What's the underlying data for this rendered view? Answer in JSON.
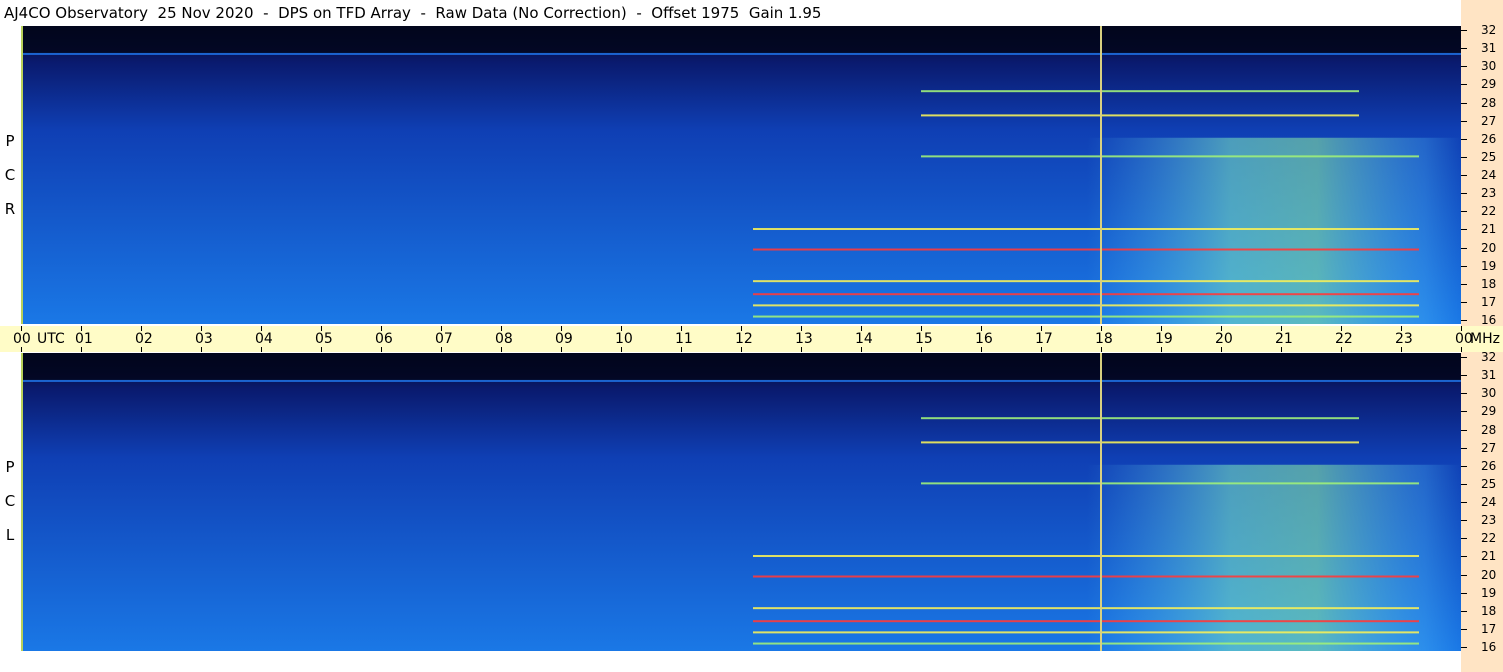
{
  "title": "AJ4CO Observatory  25 Nov 2020  -  DPS on TFD Array  -  Raw Data (No Correction)  -  Offset 1975  Gain 1.95",
  "panels": [
    {
      "id": "rcp",
      "label_chars": [
        "P",
        "C",
        "R"
      ]
    },
    {
      "id": "lcp",
      "label_chars": [
        "P",
        "C",
        "L"
      ]
    }
  ],
  "time_axis": {
    "unit": "UTC",
    "labels": [
      "00",
      "01",
      "02",
      "03",
      "04",
      "05",
      "06",
      "07",
      "08",
      "09",
      "10",
      "11",
      "12",
      "13",
      "14",
      "15",
      "16",
      "17",
      "18",
      "19",
      "20",
      "21",
      "22",
      "23",
      "00"
    ]
  },
  "freq_axis": {
    "unit": "MHz",
    "labels": [
      "32",
      "31",
      "30",
      "29",
      "28",
      "27",
      "26",
      "25",
      "24",
      "23",
      "22",
      "21",
      "20",
      "19",
      "18",
      "17",
      "16"
    ]
  },
  "colors": {
    "background_dark": "#0a1a6e",
    "sky_blue": "#1f6fe0",
    "signal_green": "#9ff07a",
    "signal_yellow": "#f5f05a",
    "signal_red": "#ff3a3a",
    "marker_line": "#d8d080",
    "axis_bg_time": "#fffcc7",
    "axis_bg_freq": "#ffe4c4"
  },
  "chart_data": [
    {
      "type": "heatmap",
      "title": "",
      "polarization": "RCP",
      "xlabel": "UTC",
      "ylabel": "MHz",
      "xlim": [
        0,
        24
      ],
      "ylim": [
        16,
        32
      ],
      "marker_time_utc": 18,
      "grid": false,
      "notable_bands_mhz": [
        30.5,
        28.5,
        27.2,
        25.0,
        21.1,
        20.0,
        18.3,
        17.6,
        17.0,
        16.4
      ],
      "signal_active_utc": [
        12,
        24
      ]
    },
    {
      "type": "heatmap",
      "title": "",
      "polarization": "LCP",
      "xlabel": "UTC",
      "ylabel": "MHz",
      "xlim": [
        0,
        24
      ],
      "ylim": [
        16,
        32
      ],
      "marker_time_utc": 18,
      "grid": false,
      "notable_bands_mhz": [
        30.5,
        28.5,
        27.2,
        25.0,
        21.1,
        20.0,
        18.3,
        17.6,
        17.0,
        16.4
      ],
      "signal_active_utc": [
        12,
        24
      ]
    }
  ]
}
